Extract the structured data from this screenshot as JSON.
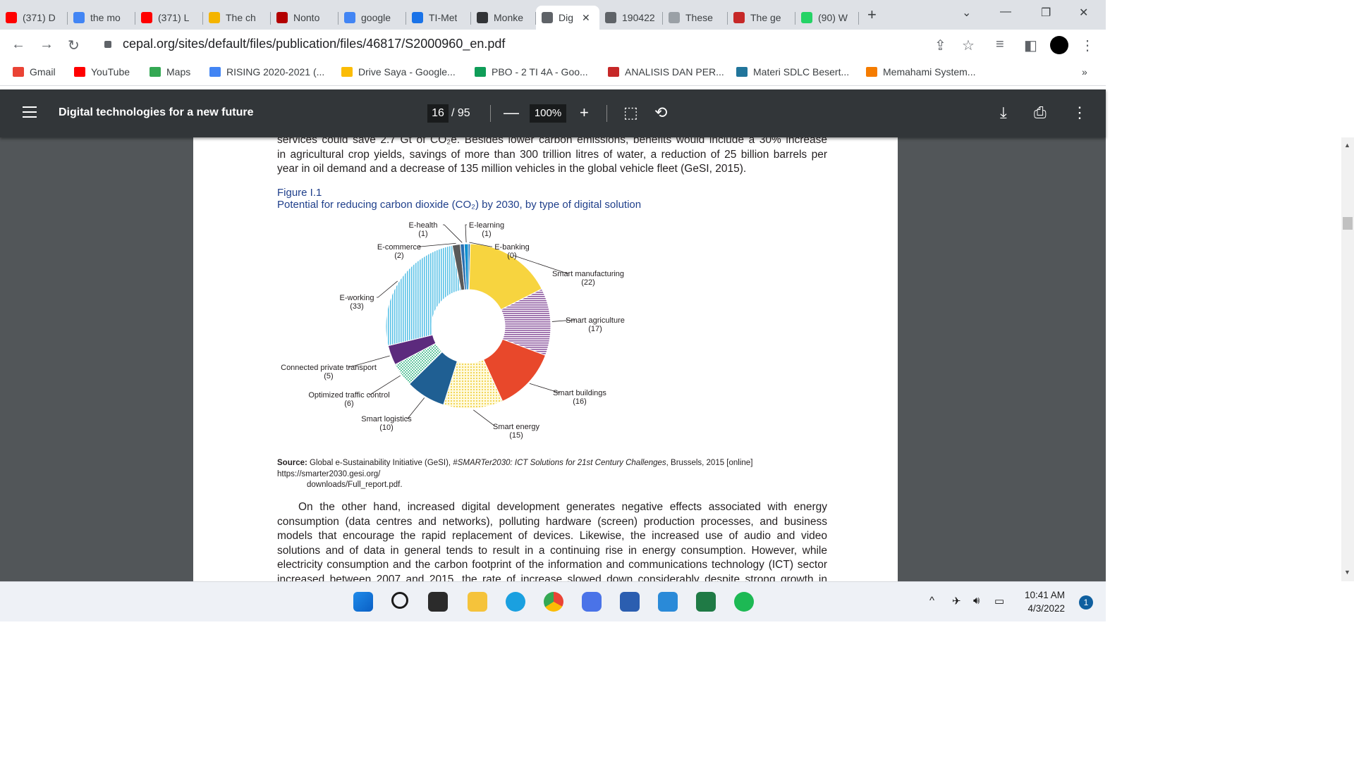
{
  "browser": {
    "tabs": [
      {
        "title": "(371) D",
        "icon": "youtube-icon"
      },
      {
        "title": "the mo",
        "icon": "google-icon"
      },
      {
        "title": "(371) L",
        "icon": "youtube-icon"
      },
      {
        "title": "The ch",
        "icon": "hand-icon"
      },
      {
        "title": "Nonto",
        "icon": "nonton-icon"
      },
      {
        "title": "google",
        "icon": "google-icon"
      },
      {
        "title": "TI-Met",
        "icon": "classroom-icon"
      },
      {
        "title": "Monke",
        "icon": "monkeytype-icon"
      },
      {
        "title": "Dig",
        "icon": "globe-icon",
        "active": true
      },
      {
        "title": "190422",
        "icon": "globe-icon"
      },
      {
        "title": "These",
        "icon": "doc-icon"
      },
      {
        "title": "The ge",
        "icon": "cio-icon"
      },
      {
        "title": "(90) W",
        "icon": "whatsapp-icon"
      }
    ],
    "url": "cepal.org/sites/default/files/publication/files/46817/S2000960_en.pdf",
    "bookmarks": [
      "Gmail",
      "YouTube",
      "Maps",
      "RISING 2020-2021 (...",
      "Drive Saya - Google...",
      "PBO - 2 TI 4A - Goo...",
      "ANALISIS DAN PER...",
      "Materi SDLC Besert...",
      "Memahami System..."
    ],
    "bookmarks_more": "»"
  },
  "pdf": {
    "title": "Digital technologies for a new future",
    "page_current": "16",
    "page_total": "/ 95",
    "zoom": "100%"
  },
  "document": {
    "para1_lines": [
      "services could save 2.7 Gt of CO₂e. Besides lower carbon emissions, benefits would include a 30% increase",
      "in agricultural crop yields, savings of more than 300 trillion litres of water, a reduction of 25 billion barrels per",
      "year in oil demand and a decrease of 135 million vehicles in the global vehicle fleet (GeSI, 2015)."
    ],
    "figure_label": "Figure I.1",
    "figure_title": "Potential for reducing carbon dioxide (CO₂) by 2030, by type of digital solution",
    "source_label": "Source:",
    "source_text_1": "Global e-Sustainability Initiative (GeSI), ",
    "source_italic": "#SMARTer2030: ICT Solutions for 21st Century Challenges",
    "source_text_2": ", Brussels, 2015 [online] https://smarter2030.gesi.org/",
    "source_text_3": "downloads/Full_report.pdf.",
    "para2_lines": [
      "On the other hand, increased digital development generates negative effects associated with energy",
      "consumption (data centres and networks), polluting hardware (screen) production processes, and business",
      "models that encourage the rapid replacement of devices. Likewise, the increased use of audio and video",
      "solutions and of data in general tends to result in a continuing rise in energy consumption. However, while",
      "electricity consumption and the carbon footprint of the information and communications technology (ICT) sector",
      "increased between 2007 and 2015, the rate of increase slowed down considerably despite strong growth in"
    ]
  },
  "chart_data": {
    "type": "pie",
    "donut": true,
    "title": "Potential for reducing carbon dioxide (CO₂) by 2030, by type of digital solution",
    "slices": [
      {
        "label": "E-banking",
        "value": 0,
        "color": "#1f6fb2"
      },
      {
        "label": "Smart manufacturing",
        "value": 22,
        "color": "#f7d43f"
      },
      {
        "label": "Smart agriculture",
        "value": 17,
        "color": "#8e5aa0"
      },
      {
        "label": "Smart buildings",
        "value": 16,
        "color": "#e8482b"
      },
      {
        "label": "Smart energy",
        "value": 15,
        "color": "#f5df6a"
      },
      {
        "label": "Smart logistics",
        "value": 10,
        "color": "#1f5f93"
      },
      {
        "label": "Optimized traffic control",
        "value": 6,
        "color": "#66c7a2"
      },
      {
        "label": "Connected private transport",
        "value": 5,
        "color": "#5c2a7d"
      },
      {
        "label": "E-working",
        "value": 33,
        "color": "#5bc2e7"
      },
      {
        "label": "E-commerce",
        "value": 2,
        "color": "#5a5a5a"
      },
      {
        "label": "E-health",
        "value": 1,
        "color": "#2a6fb0"
      },
      {
        "label": "E-learning",
        "value": 1,
        "color": "#0e8fcf"
      }
    ]
  },
  "taskbar": {
    "time": "10:41 AM",
    "date": "4/3/2022",
    "notifications": "1"
  }
}
